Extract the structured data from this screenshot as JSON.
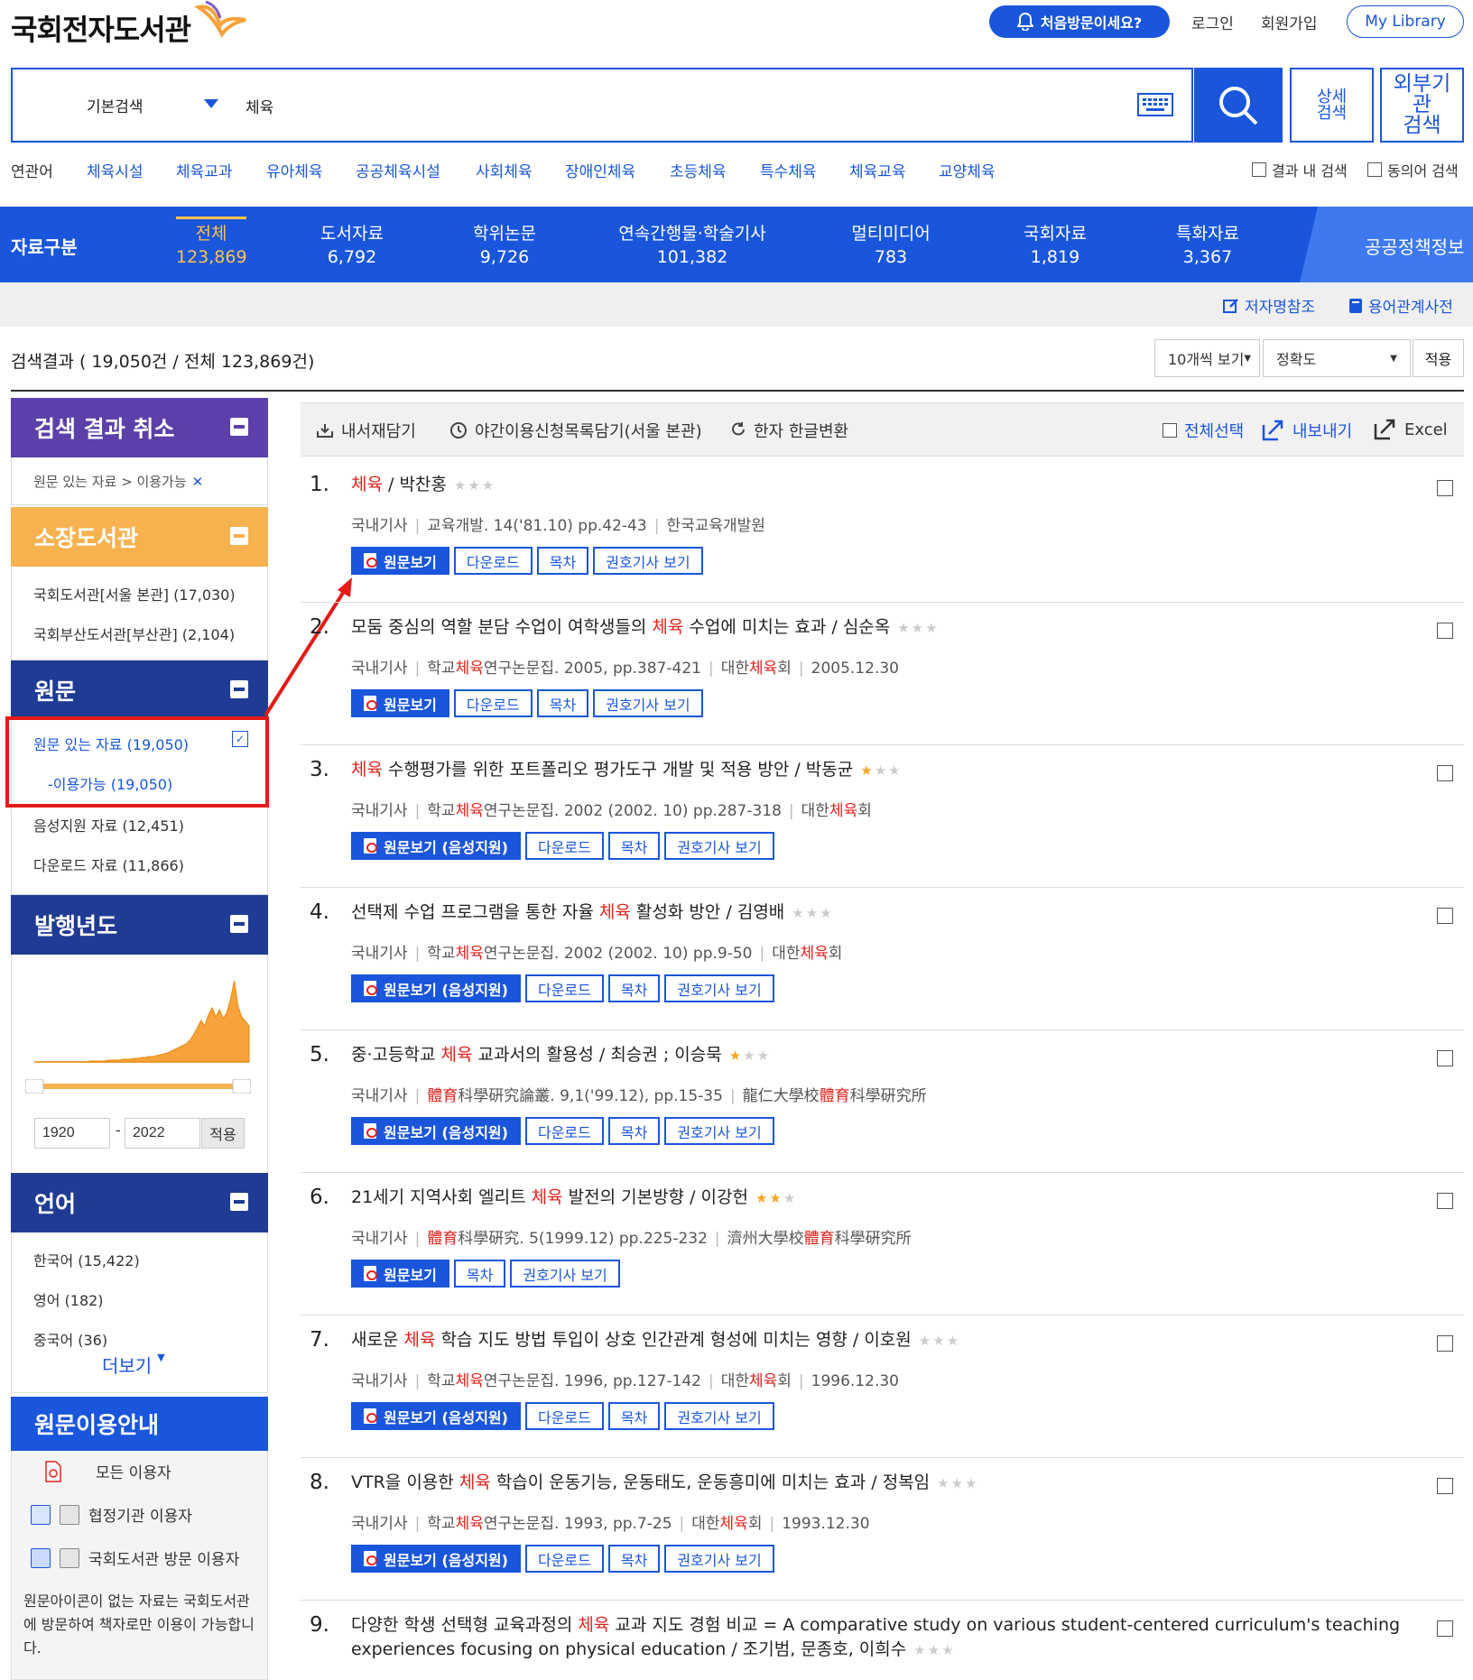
{
  "header": {
    "logo": "국회전자도서관",
    "first_visit": "처음방문이세요?",
    "login": "로그인",
    "signup": "회원가입",
    "my_library": "My Library"
  },
  "search": {
    "type": "기본검색",
    "query": "체육",
    "advanced_line1": "상세",
    "advanced_line2": "검색",
    "external_line1": "외부기",
    "external_line2": "관",
    "external_line3": "검색"
  },
  "related": {
    "label": "연관어",
    "terms": [
      "체육시설",
      "체육교과",
      "유아체육",
      "공공체육시설",
      "사회체육",
      "장애인체육",
      "초등체육",
      "특수체육",
      "체육교육",
      "교양체육"
    ],
    "within_results": "결과 내 검색",
    "synonym": "동의어 검색"
  },
  "categories": {
    "label": "자료구분",
    "items": [
      {
        "name": "전체",
        "count": "123,869"
      },
      {
        "name": "도서자료",
        "count": "6,792"
      },
      {
        "name": "학위논문",
        "count": "9,726"
      },
      {
        "name": "연속간행물·학술기사",
        "count": "101,382"
      },
      {
        "name": "멀티미디어",
        "count": "783"
      },
      {
        "name": "국회자료",
        "count": "1,819"
      },
      {
        "name": "특화자료",
        "count": "3,367"
      }
    ],
    "policy": "공공정책정보"
  },
  "tools": {
    "author_ref": "저자명참조",
    "term_dict": "용어관계사전"
  },
  "results": {
    "summary_prefix": "검색결과 ( ",
    "summary_count": "19,050건",
    "summary_mid": " / 전체 ",
    "summary_total": "123,869건",
    "summary_suffix": ")",
    "per_page": "10개씩 보기",
    "sort": "정확도",
    "apply": "적용"
  },
  "sidebar": {
    "cancel_title": "검색 결과 취소",
    "cancel_filter": "원문 있는 자료 > 이용가능",
    "library_title": "소장도서관",
    "libraries": [
      "국회도서관[서울 본관] (17,030)",
      "국회부산도서관[부산관] (2,104)"
    ],
    "original_title": "원문",
    "original_selected": "원문 있는 자료 (19,050)",
    "original_sub": "-이용가능 (19,050)",
    "original_others": [
      "음성지원 자료 (12,451)",
      "다운로드 자료 (11,866)"
    ],
    "year_title": "발행년도",
    "year_from": "1920",
    "year_to": "2022",
    "year_apply": "적용",
    "lang_title": "언어",
    "languages": [
      "한국어 (15,422)",
      "영어 (182)",
      "중국어 (36)"
    ],
    "more": "더보기",
    "guide_title": "원문이용안내",
    "guide_rows": [
      "모든 이용자",
      "협정기관 이용자",
      "국회도서관 방문 이용자"
    ],
    "guide_text": "원문아이콘이 없는 자료는 국회도서관에 방문하여 책자로만 이용이 가능합니다."
  },
  "list_tools": {
    "cart": "내서재담기",
    "night": "야간이용신청목록담기(서울 본관)",
    "hanja": "한자 한글변환",
    "select_all": "전체선택",
    "export": "내보내기",
    "excel": "Excel"
  },
  "buttons": {
    "view": "원문보기",
    "view_voice": "원문보기 (음성지원)",
    "download": "다운로드",
    "toc": "목차",
    "issue": "권호기사 보기"
  },
  "items": [
    {
      "no": "1.",
      "pre": "",
      "hl": "체육",
      "post": " / 박찬홍",
      "stars": 0,
      "meta1": "국내기사",
      "meta2": "교육개발. 14('81.10) pp.42-43",
      "meta3": "한국교육개발원",
      "meta4": ""
    },
    {
      "no": "2.",
      "pre": "모둠 중심의 역할 분담 수업이 여학생들의 ",
      "hl": "체육",
      "post": " 수업에 미치는 효과 / 심순옥",
      "stars": 0,
      "meta1": "국내기사",
      "meta2": "학교체육연구논문집. 2005, pp.387-421",
      "meta3": "대한체육회",
      "meta4": "2005.12.30"
    },
    {
      "no": "3.",
      "pre": "",
      "hl": "체육",
      "post": " 수행평가를 위한 포트폴리오 평가도구 개발 및 적용 방안 / 박동균",
      "stars": 1,
      "meta1": "국내기사",
      "meta2": "학교체육연구논문집. 2002 (2002. 10) pp.287-318",
      "meta3": "대한체육회",
      "meta4": ""
    },
    {
      "no": "4.",
      "pre": "선택제 수업 프로그램을 통한 자율 ",
      "hl": "체육",
      "post": " 활성화 방안 / 김영배",
      "stars": 0,
      "meta1": "국내기사",
      "meta2": "학교체육연구논문집. 2002 (2002. 10) pp.9-50",
      "meta3": "대한체육회",
      "meta4": ""
    },
    {
      "no": "5.",
      "pre": "중·고등학교 ",
      "hl": "체육",
      "post": " 교과서의 활용성 / 최승권 ; 이승묵",
      "stars": 0.5,
      "meta1": "국내기사",
      "meta2": "體育科學硏究論叢. 9,1('99.12), pp.15-35",
      "meta3": "龍仁大學校體育科學硏究所",
      "meta4": ""
    },
    {
      "no": "6.",
      "pre": "21세기 지역사회 엘리트 ",
      "hl": "체육",
      "post": " 발전의 기본방향 / 이강헌",
      "stars": 2,
      "meta1": "국내기사",
      "meta2": "體育科學硏究. 5(1999.12) pp.225-232",
      "meta3": "濟州大學校體育科學硏究所",
      "meta4": ""
    },
    {
      "no": "7.",
      "pre": "새로운 ",
      "hl": "체육",
      "post": " 학습 지도 방법 투입이 상호 인간관계 형성에 미치는 영향 / 이호원",
      "stars": 0,
      "meta1": "국내기사",
      "meta2": "학교체육연구논문집. 1996, pp.127-142",
      "meta3": "대한체육회",
      "meta4": "1996.12.30"
    },
    {
      "no": "8.",
      "pre": "VTR을 이용한 ",
      "hl": "체육",
      "post": " 학습이 운동기능, 운동태도, 운동흥미에 미치는 효과 / 정복임",
      "stars": 0,
      "meta1": "국내기사",
      "meta2": "학교체육연구논문집. 1993, pp.7-25",
      "meta3": "대한체육회",
      "meta4": "1993.12.30"
    },
    {
      "no": "9.",
      "pre": "다양한 학생 선택형 교육과정의 ",
      "hl": "체육",
      "post": " 교과 지도 경험 비교 = A comparative study on various student-centered curriculum's teaching experiences focusing on physical education / 조기범, 문종호, 이희수",
      "stars": 0,
      "meta1": "",
      "meta2": "",
      "meta3": "",
      "meta4": ""
    }
  ],
  "year_series": [
    0,
    0,
    0,
    0,
    0,
    0,
    0,
    0,
    0,
    0,
    0,
    0,
    0,
    0,
    0,
    1,
    1,
    1,
    1,
    1,
    2,
    2,
    2,
    2,
    3,
    3,
    3,
    4,
    4,
    5,
    5,
    6,
    6,
    7,
    8,
    9,
    10,
    12,
    14,
    16,
    18,
    20,
    24,
    30,
    38,
    46,
    40,
    52,
    60,
    50,
    58,
    48,
    55,
    70,
    90,
    62,
    50,
    45,
    40
  ]
}
